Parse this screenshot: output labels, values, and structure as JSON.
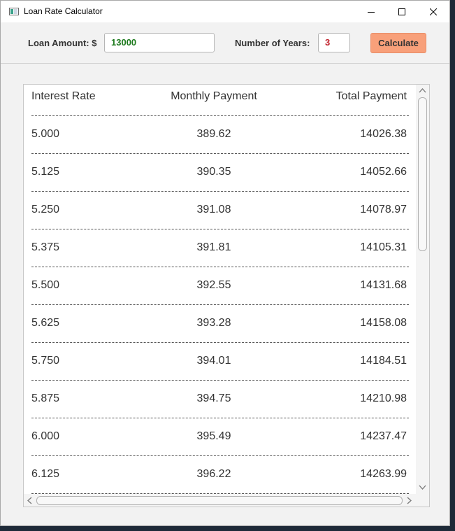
{
  "window": {
    "title": "Loan Rate Calculator"
  },
  "form": {
    "amount_label": "Loan Amount: $",
    "amount_value": "13000",
    "years_label": "Number of Years:",
    "years_value": "3",
    "calculate_label": "Calculate"
  },
  "results": {
    "headers": [
      "Interest Rate",
      "Monthly Payment",
      "Total Payment"
    ],
    "rows": [
      [
        "5.000",
        "389.62",
        "14026.38"
      ],
      [
        "5.125",
        "390.35",
        "14052.66"
      ],
      [
        "5.250",
        "391.08",
        "14078.97"
      ],
      [
        "5.375",
        "391.81",
        "14105.31"
      ],
      [
        "5.500",
        "392.55",
        "14131.68"
      ],
      [
        "5.625",
        "393.28",
        "14158.08"
      ],
      [
        "5.750",
        "394.01",
        "14184.51"
      ],
      [
        "5.875",
        "394.75",
        "14210.98"
      ],
      [
        "6.000",
        "395.49",
        "14237.47"
      ],
      [
        "6.125",
        "396.22",
        "14263.99"
      ]
    ]
  },
  "colors": {
    "amount_text": "#1d7a1d",
    "years_text": "#c0202a",
    "calculate_button": "#f8a07a"
  },
  "icons": {
    "app": "app-window-icon",
    "minimize": "minimize-icon",
    "maximize": "maximize-icon",
    "close": "close-icon"
  }
}
